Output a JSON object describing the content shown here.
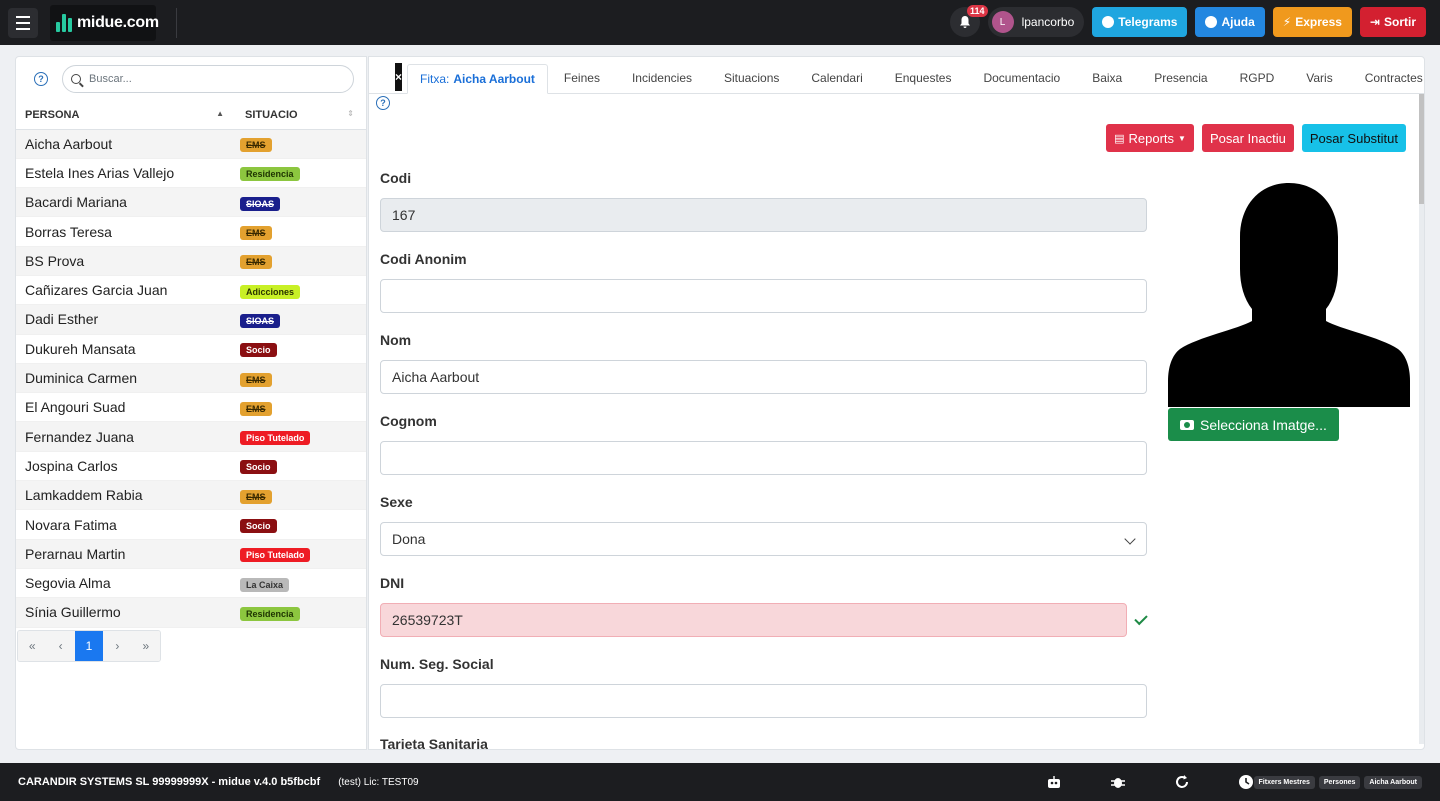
{
  "brand": {
    "name": "midue.com"
  },
  "topbar": {
    "notifications": "114",
    "user_initial": "L",
    "username": "lpancorbo",
    "buttons": {
      "telegram": "Telegrams",
      "ajuda": "Ajuda",
      "express": "Express",
      "sortir": "Sortir"
    }
  },
  "sidebar": {
    "search_placeholder": "Buscar...",
    "col_persona": "PERSONA",
    "col_situacio": "SITUACIO",
    "rows": [
      {
        "name": "Aicha Aarbout",
        "situacio": "EMS"
      },
      {
        "name": "Estela Ines Arias Vallejo",
        "situacio": "Residencia"
      },
      {
        "name": "Bacardi Mariana",
        "situacio": "SIOAS"
      },
      {
        "name": "Borras Teresa",
        "situacio": "EMS"
      },
      {
        "name": "BS Prova",
        "situacio": "EMS"
      },
      {
        "name": "Cañizares Garcia Juan",
        "situacio": "Adicciones"
      },
      {
        "name": "Dadi Esther",
        "situacio": "SIOAS"
      },
      {
        "name": "Dukureh Mansata",
        "situacio": "Socio"
      },
      {
        "name": "Duminica Carmen",
        "situacio": "EMS"
      },
      {
        "name": "El Angouri Suad",
        "situacio": "EMS"
      },
      {
        "name": "Fernandez Juana",
        "situacio": "Piso Tutelado"
      },
      {
        "name": "Jospina Carlos",
        "situacio": "Socio"
      },
      {
        "name": "Lamkaddem Rabia",
        "situacio": "EMS"
      },
      {
        "name": "Novara Fatima",
        "situacio": "Socio"
      },
      {
        "name": "Perarnau Martin",
        "situacio": "Piso Tutelado"
      },
      {
        "name": "Segovia Alma",
        "situacio": "La Caixa"
      },
      {
        "name": "Sínia Guillermo",
        "situacio": "Residencia"
      }
    ],
    "pager": {
      "first": "«",
      "prev": "‹",
      "current": "1",
      "next": "›",
      "last": "»"
    }
  },
  "badge_colors": {
    "EMS": {
      "bg": "#e3a12f",
      "fg": "#3a2a00",
      "strike": true
    },
    "Residencia": {
      "bg": "#8cc63f",
      "fg": "#1d3300",
      "strike": false
    },
    "SIOAS": {
      "bg": "#1a1f8c",
      "fg": "#ffffff",
      "strike": true
    },
    "Adicciones": {
      "bg": "#c8f026",
      "fg": "#2a3300",
      "strike": false
    },
    "Socio": {
      "bg": "#8b0f12",
      "fg": "#ffffff",
      "strike": false
    },
    "Piso Tutelado": {
      "bg": "#ee1c24",
      "fg": "#ffffff",
      "strike": false
    },
    "La Caixa": {
      "bg": "#b9b9b9",
      "fg": "#333333",
      "strike": false
    }
  },
  "tabs": {
    "close": "×",
    "active_prefix": "Fitxa:",
    "active_name": "Aicha Aarbout",
    "items": [
      "Feines",
      "Incidencies",
      "Situacions",
      "Calendari",
      "Enquestes",
      "Documentacio",
      "Baixa",
      "Presencia",
      "RGPD",
      "Varis",
      "Contractes"
    ],
    "more": "›"
  },
  "actions": {
    "reports": "Reports",
    "inactiu": "Posar Inactiu",
    "substitut": "Posar Substitut"
  },
  "form": {
    "codi_label": "Codi",
    "codi_value": "167",
    "codi_anonim_label": "Codi Anonim",
    "codi_anonim_value": "",
    "nom_label": "Nom",
    "nom_value": "Aicha Aarbout",
    "cognom_label": "Cognom",
    "cognom_value": "",
    "sexe_label": "Sexe",
    "sexe_value": "Dona",
    "dni_label": "DNI",
    "dni_value": "26539723T",
    "segsoc_label": "Num. Seg. Social",
    "segsoc_value": "",
    "tarjeta_label": "Tarjeta Sanitaria"
  },
  "photo": {
    "button": "Selecciona Imatge..."
  },
  "footer": {
    "company": "CARANDIR SYSTEMS SL 99999999X - midue v.4.0 b5fbcbf",
    "license": "(test) Lic: TEST09",
    "crumbs": [
      "Fitxers Mestres",
      "Persones",
      "Aicha Aarbout"
    ]
  }
}
